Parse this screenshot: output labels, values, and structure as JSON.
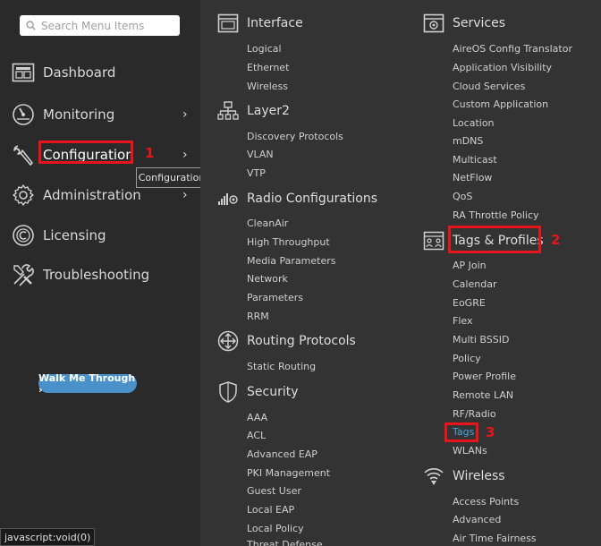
{
  "search": {
    "placeholder": "Search Menu Items"
  },
  "nav": [
    {
      "label": "Dashboard",
      "icon": "dashboard-icon",
      "chevron": ""
    },
    {
      "label": "Monitoring",
      "icon": "monitoring-icon",
      "chevron": "›"
    },
    {
      "label": "Configuration",
      "icon": "wrench-icon",
      "chevron": "›"
    },
    {
      "label": "Administration",
      "icon": "gear-icon",
      "chevron": "›"
    },
    {
      "label": "Licensing",
      "icon": "licensing-icon",
      "chevron": ""
    },
    {
      "label": "Troubleshooting",
      "icon": "tools-icon",
      "chevron": ""
    }
  ],
  "tooltip": "Configuration",
  "walk_button": "Walk Me Through ›",
  "status_text": "javascript:void(0)",
  "annotations": [
    "1",
    "2",
    "3"
  ],
  "colors": {
    "highlight": "#e8141b",
    "active_link": "#4da3d9",
    "walk_button": "#4a90c9"
  },
  "columns": {
    "left": [
      {
        "title": "Interface",
        "icon": "interface-icon",
        "items": [
          "Logical",
          "Ethernet",
          "Wireless"
        ]
      },
      {
        "title": "Layer2",
        "icon": "layer2-icon",
        "items": [
          "Discovery Protocols",
          "VLAN",
          "VTP"
        ]
      },
      {
        "title": "Radio Configurations",
        "icon": "radio-icon",
        "items": [
          "CleanAir",
          "High Throughput",
          "Media Parameters",
          "Network",
          "Parameters",
          "RRM"
        ]
      },
      {
        "title": "Routing Protocols",
        "icon": "routing-icon",
        "items": [
          "Static Routing"
        ]
      },
      {
        "title": "Security",
        "icon": "shield-icon",
        "items": [
          "AAA",
          "ACL",
          "Advanced EAP",
          "PKI Management",
          "Guest User",
          "Local EAP",
          "Local Policy",
          "Threat Defense"
        ]
      }
    ],
    "right": [
      {
        "title": "Services",
        "icon": "services-icon",
        "items": [
          "AireOS Config Translator",
          "Application Visibility",
          "Cloud Services",
          "Custom Application",
          "Location",
          "mDNS",
          "Multicast",
          "NetFlow",
          "QoS",
          "RA Throttle Policy"
        ]
      },
      {
        "title": "Tags & Profiles",
        "icon": "tags-profiles-icon",
        "items": [
          "AP Join",
          "Calendar",
          "EoGRE",
          "Flex",
          "Multi BSSID",
          "Policy",
          "Power Profile",
          "Remote LAN",
          "RF/Radio",
          "Tags",
          "WLANs"
        ]
      },
      {
        "title": "Wireless",
        "icon": "wireless-icon",
        "items": [
          "Access Points",
          "Advanced",
          "Air Time Fairness"
        ]
      }
    ]
  }
}
